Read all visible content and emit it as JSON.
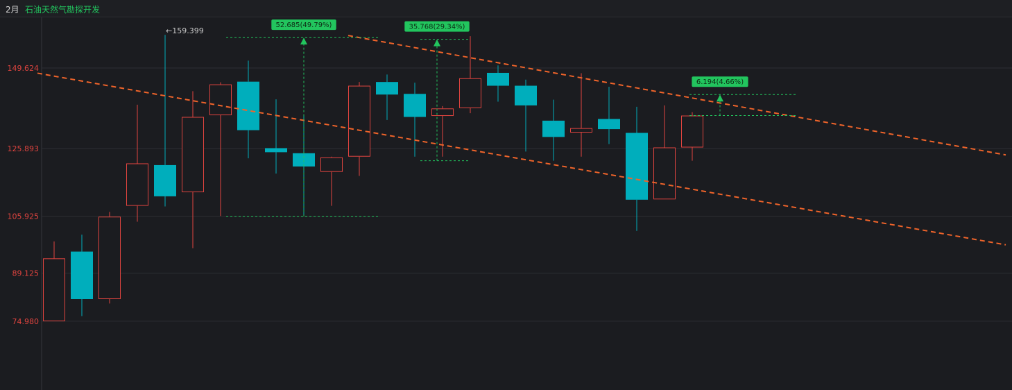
{
  "header": {
    "period": "2月",
    "stock_name": "石油天然气勘探开发"
  },
  "colors": {
    "up": "#e0443f",
    "down": "#00aebc",
    "trendline": "#f0642a",
    "measure": "#22c55e",
    "grid": "#2c2e33",
    "background": "#1b1c20"
  },
  "chart_data": {
    "type": "candlestick",
    "y_ticks": [
      "149.624",
      "125.893",
      "105.925",
      "89.125",
      "74.980"
    ],
    "ylim": [
      74.98,
      159.4
    ],
    "max_marker": {
      "label": "←159.399",
      "value": 159.399,
      "candle_index": 4
    },
    "candles": [
      {
        "o": 74.98,
        "h": 98.5,
        "l": 74.98,
        "c": 93.5
      },
      {
        "o": 95.5,
        "h": 100.5,
        "l": 76.5,
        "c": 81.5
      },
      {
        "o": 81.5,
        "h": 107.2,
        "l": 80.2,
        "c": 105.8
      },
      {
        "o": 109.0,
        "h": 138.8,
        "l": 104.3,
        "c": 121.5
      },
      {
        "o": 121.0,
        "h": 159.4,
        "l": 108.8,
        "c": 111.8
      },
      {
        "o": 113.0,
        "h": 142.8,
        "l": 96.5,
        "c": 135.2
      },
      {
        "o": 135.7,
        "h": 145.4,
        "l": 106.0,
        "c": 144.8
      },
      {
        "o": 145.6,
        "h": 151.8,
        "l": 123.0,
        "c": 131.3
      },
      {
        "o": 126.0,
        "h": 140.4,
        "l": 118.5,
        "c": 124.8
      },
      {
        "o": 124.5,
        "h": 135.7,
        "l": 106.0,
        "c": 120.6
      },
      {
        "o": 119.0,
        "h": 123.5,
        "l": 109.0,
        "c": 123.3
      },
      {
        "o": 123.5,
        "h": 145.5,
        "l": 117.8,
        "c": 144.4
      },
      {
        "o": 145.5,
        "h": 147.7,
        "l": 134.3,
        "c": 141.8
      },
      {
        "o": 142.0,
        "h": 145.3,
        "l": 123.5,
        "c": 135.2
      },
      {
        "o": 135.5,
        "h": 138.4,
        "l": 123.5,
        "c": 137.7
      },
      {
        "o": 137.8,
        "h": 159.0,
        "l": 136.3,
        "c": 146.6
      },
      {
        "o": 148.2,
        "h": 150.4,
        "l": 139.7,
        "c": 144.4
      },
      {
        "o": 144.4,
        "h": 146.2,
        "l": 125.0,
        "c": 138.6
      },
      {
        "o": 134.1,
        "h": 140.3,
        "l": 122.3,
        "c": 129.3
      },
      {
        "o": 130.6,
        "h": 148.1,
        "l": 123.5,
        "c": 131.9
      },
      {
        "o": 134.6,
        "h": 144.1,
        "l": 127.2,
        "c": 131.6
      },
      {
        "o": 130.5,
        "h": 138.2,
        "l": 101.6,
        "c": 110.8
      },
      {
        "o": 110.9,
        "h": 138.6,
        "l": 110.9,
        "c": 126.2
      },
      {
        "o": 126.2,
        "h": 136.6,
        "l": 122.3,
        "c": 135.6
      }
    ],
    "trendlines": [
      {
        "from": {
          "index": -0.6,
          "value": 148.1
        },
        "to": {
          "index": 34.3,
          "value": 97.5
        }
      },
      {
        "from": {
          "index": 10.6,
          "value": 159.2
        },
        "to": {
          "index": 34.3,
          "value": 124.0
        }
      }
    ],
    "measures": [
      {
        "label": "52.685(49.79%)",
        "from_index": 9.0,
        "base": 105.925,
        "target": 158.61,
        "span": [
          6.2,
          11.7
        ]
      },
      {
        "label": "35.768(29.34%)",
        "from_index": 13.8,
        "base": 122.3,
        "target": 158.1,
        "span": [
          13.2,
          15.0
        ]
      },
      {
        "label": "6.194(4.66%)",
        "from_index": 24.0,
        "base": 135.6,
        "target": 141.8,
        "span": [
          22.9,
          26.8
        ]
      }
    ]
  }
}
